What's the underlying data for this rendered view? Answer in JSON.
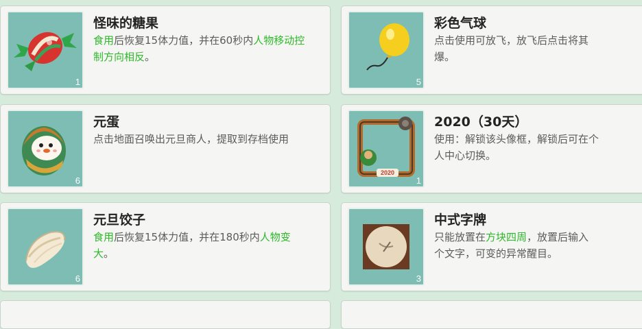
{
  "items": [
    {
      "title": "怪味的糖果",
      "count": "1",
      "icon": "candy-icon",
      "desc": [
        {
          "t": "食用",
          "h": true
        },
        {
          "t": "后恢复15体力值，并在60秒内",
          "h": false
        },
        {
          "t": "人物移动控制方向相反",
          "h": true
        },
        {
          "t": "。",
          "h": false
        }
      ]
    },
    {
      "title": "彩色气球",
      "count": "5",
      "icon": "balloon-icon",
      "desc": [
        {
          "t": "点击使用可放飞，放飞后点击将其",
          "h": false
        },
        {
          "t": "爆。",
          "h": false
        }
      ]
    },
    {
      "title": "元蛋",
      "count": "6",
      "icon": "egg-icon",
      "desc": [
        {
          "t": "点击地面召唤出元旦商人，提取到存档使用",
          "h": false
        }
      ]
    },
    {
      "title": "2020（30天）",
      "count": "1",
      "icon": "avatar-frame-icon",
      "frame_text": "2020",
      "desc": [
        {
          "t": "使用：解锁该头像框，解锁后可在个",
          "h": false
        },
        {
          "t": "人中心切换。",
          "h": false
        }
      ]
    },
    {
      "title": "元旦饺子",
      "count": "6",
      "icon": "dumpling-icon",
      "desc": [
        {
          "t": "食用",
          "h": true
        },
        {
          "t": "后恢复15体力值，并在180秒内",
          "h": false
        },
        {
          "t": "人物变大",
          "h": true
        },
        {
          "t": "。",
          "h": false
        }
      ]
    },
    {
      "title": "中式字牌",
      "count": "3",
      "icon": "chinese-sign-icon",
      "desc": [
        {
          "t": "只能放置在",
          "h": false
        },
        {
          "t": "方块四周",
          "h": true
        },
        {
          "t": "，放置后输入",
          "h": false
        },
        {
          "t": "个文字，可变的异常醒目。",
          "h": false
        }
      ]
    }
  ],
  "colors": {
    "background": "#d6ebdc",
    "card": "#f5f6f3",
    "thumb": "#7dbdb3",
    "highlight": "#2fb82a"
  }
}
